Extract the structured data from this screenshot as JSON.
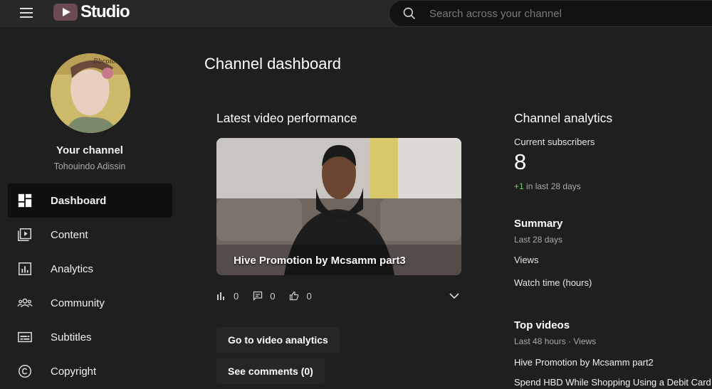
{
  "header": {
    "logo_text": "Studio",
    "search_placeholder": "Search across your channel"
  },
  "sidebar": {
    "channel_title": "Your channel",
    "channel_name": "Tohouindo Adissin",
    "items": [
      {
        "label": "Dashboard",
        "icon": "dashboard-icon",
        "active": true
      },
      {
        "label": "Content",
        "icon": "content-icon"
      },
      {
        "label": "Analytics",
        "icon": "analytics-icon"
      },
      {
        "label": "Community",
        "icon": "community-icon"
      },
      {
        "label": "Subtitles",
        "icon": "subtitles-icon"
      },
      {
        "label": "Copyright",
        "icon": "copyright-icon"
      }
    ]
  },
  "main": {
    "page_title": "Channel dashboard",
    "latest": {
      "title": "Latest video performance",
      "video_title": "Hive Promotion by Mcsamm part3",
      "views": "0",
      "comments": "0",
      "likes": "0",
      "go_analytics": "Go to video analytics",
      "see_comments": "See comments (0)"
    },
    "analytics": {
      "title": "Channel analytics",
      "subscribers_label": "Current subscribers",
      "subscribers_value": "8",
      "growth_delta": "+1",
      "growth_period": "in last 28 days",
      "summary_title": "Summary",
      "summary_period": "Last 28 days",
      "views_label": "Views",
      "watch_time_label": "Watch time (hours)",
      "top_videos_title": "Top videos",
      "top_videos_period": "Last 48 hours · Views",
      "top_videos": [
        "Hive Promotion by Mcsamm part2",
        "Spend HBD While Shopping Using a Debit Card"
      ]
    }
  },
  "colors": {
    "background": "#1f1f1f",
    "header": "#282828",
    "active_nav": "#0f0f0f",
    "growth_positive": "#6fcf6f"
  }
}
